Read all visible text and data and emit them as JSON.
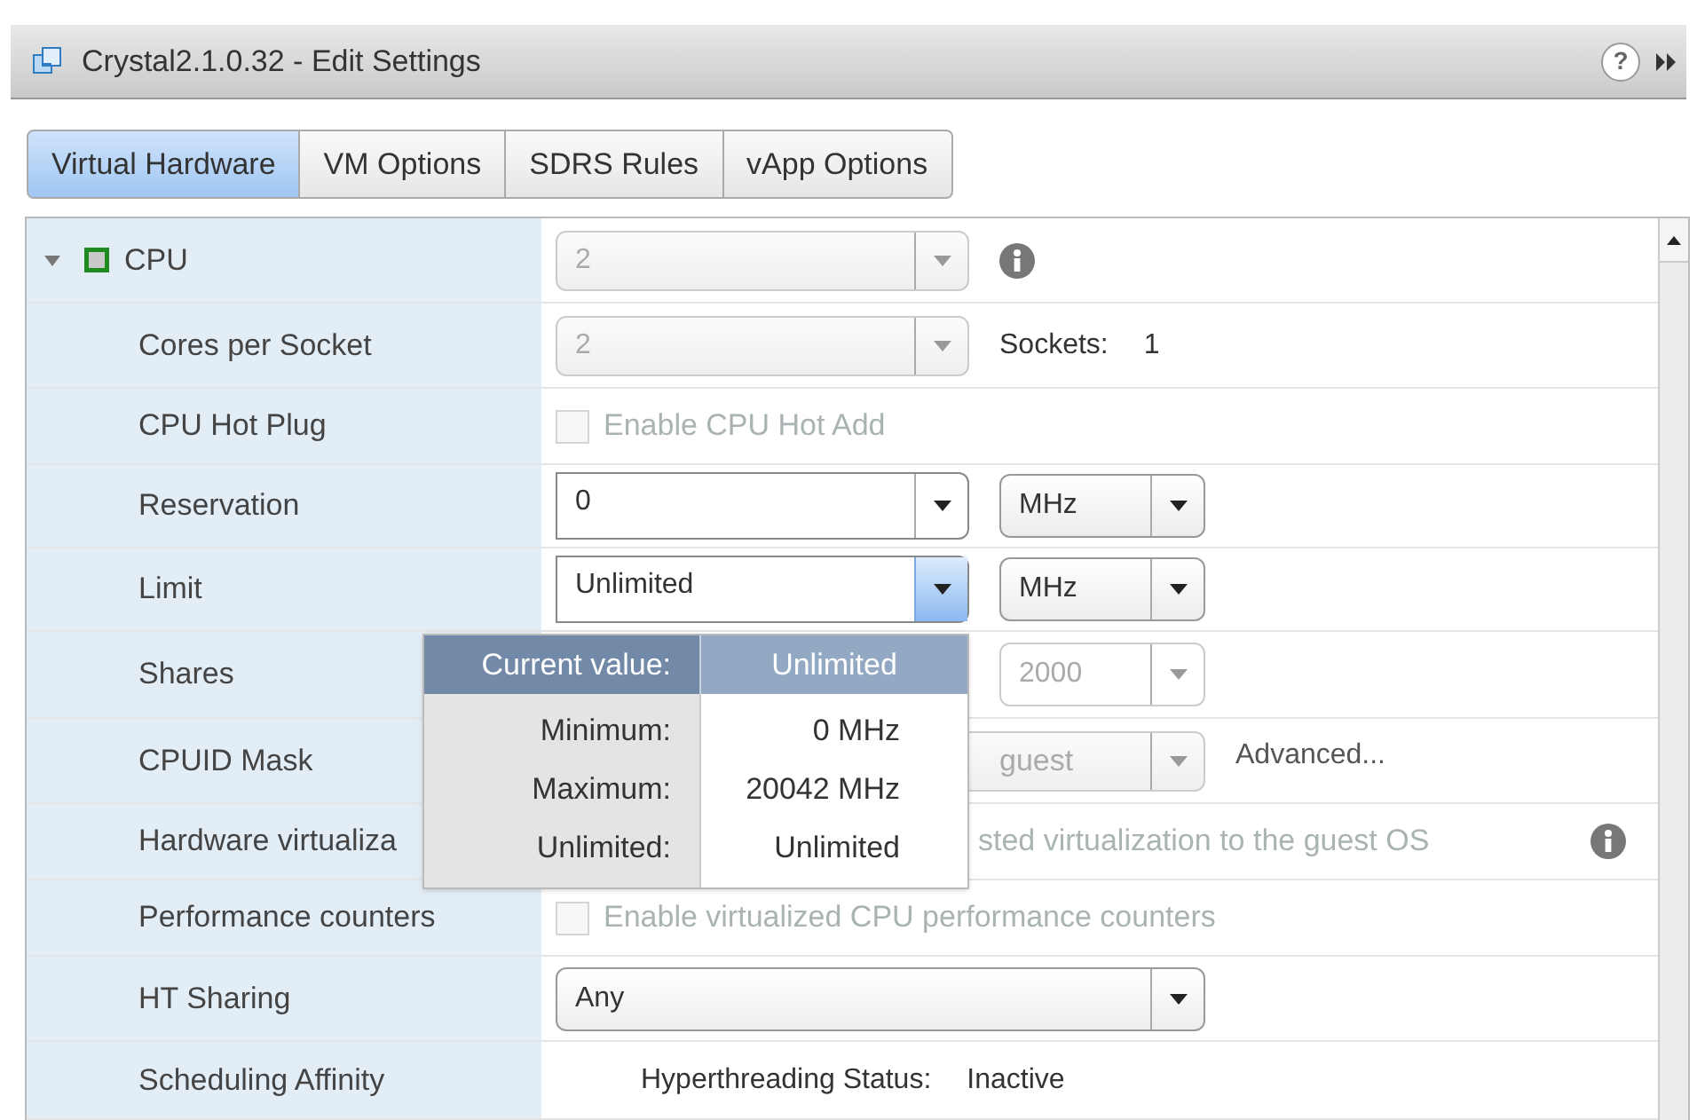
{
  "window": {
    "title": "Crystal2.1.0.32 - Edit Settings",
    "help": "?"
  },
  "tabs": [
    {
      "label": "Virtual Hardware",
      "selected": true
    },
    {
      "label": "VM Options",
      "selected": false
    },
    {
      "label": "SDRS Rules",
      "selected": false
    },
    {
      "label": "vApp Options",
      "selected": false
    }
  ],
  "rows": [
    {
      "label": "CPU",
      "expanded": true,
      "controls": [
        {
          "kind": "select",
          "value": "2",
          "disabled": true
        },
        {
          "kind": "info"
        }
      ]
    },
    {
      "label": "Cores per Socket",
      "controls": [
        {
          "kind": "select",
          "value": "2",
          "disabled": true
        },
        {
          "kind": "pair",
          "label": "Sockets:",
          "value": "1"
        }
      ]
    },
    {
      "label": "CPU Hot Plug",
      "controls": [
        {
          "kind": "checkbox",
          "label": "Enable CPU Hot Add",
          "checked": false,
          "disabled": true
        }
      ]
    },
    {
      "label": "Reservation",
      "controls": [
        {
          "kind": "combo",
          "value": "0",
          "focused": false
        },
        {
          "kind": "unit",
          "value": "MHz",
          "disabled": false
        }
      ]
    },
    {
      "label": "Limit",
      "controls": [
        {
          "kind": "combo",
          "value": "Unlimited",
          "focused": true
        },
        {
          "kind": "unit",
          "value": "MHz",
          "disabled": false
        }
      ]
    },
    {
      "label": "Shares",
      "controls": [
        {
          "kind": "spacer"
        },
        {
          "kind": "unit",
          "value": "2000",
          "disabled": true
        }
      ]
    },
    {
      "label": "CPUID Mask",
      "controls": [
        {
          "kind": "covered_select",
          "value": "guest"
        },
        {
          "kind": "link",
          "label": "Advanced..."
        }
      ]
    },
    {
      "label": "Hardware virtualiza",
      "controls": [
        {
          "kind": "covered_text",
          "label": "sted virtualization to the guest OS"
        },
        {
          "kind": "info_right"
        }
      ]
    },
    {
      "label": "Performance counters",
      "controls": [
        {
          "kind": "checkbox",
          "label": "Enable virtualized CPU performance counters",
          "checked": false,
          "disabled": true
        }
      ]
    },
    {
      "label": "HT Sharing",
      "controls": [
        {
          "kind": "wide_select",
          "value": "Any"
        }
      ]
    },
    {
      "label": "Scheduling Affinity",
      "controls": [
        {
          "kind": "pair",
          "label": "Hyperthreading Status:",
          "value": "Inactive"
        }
      ]
    }
  ],
  "popup": {
    "header": {
      "label": "Current value:",
      "value": "Unlimited"
    },
    "rows": [
      {
        "label": "Minimum:",
        "value": "0 MHz"
      },
      {
        "label": "Maximum:",
        "value": "20042 MHz"
      },
      {
        "label": "Unlimited:",
        "value": "Unlimited"
      }
    ]
  }
}
